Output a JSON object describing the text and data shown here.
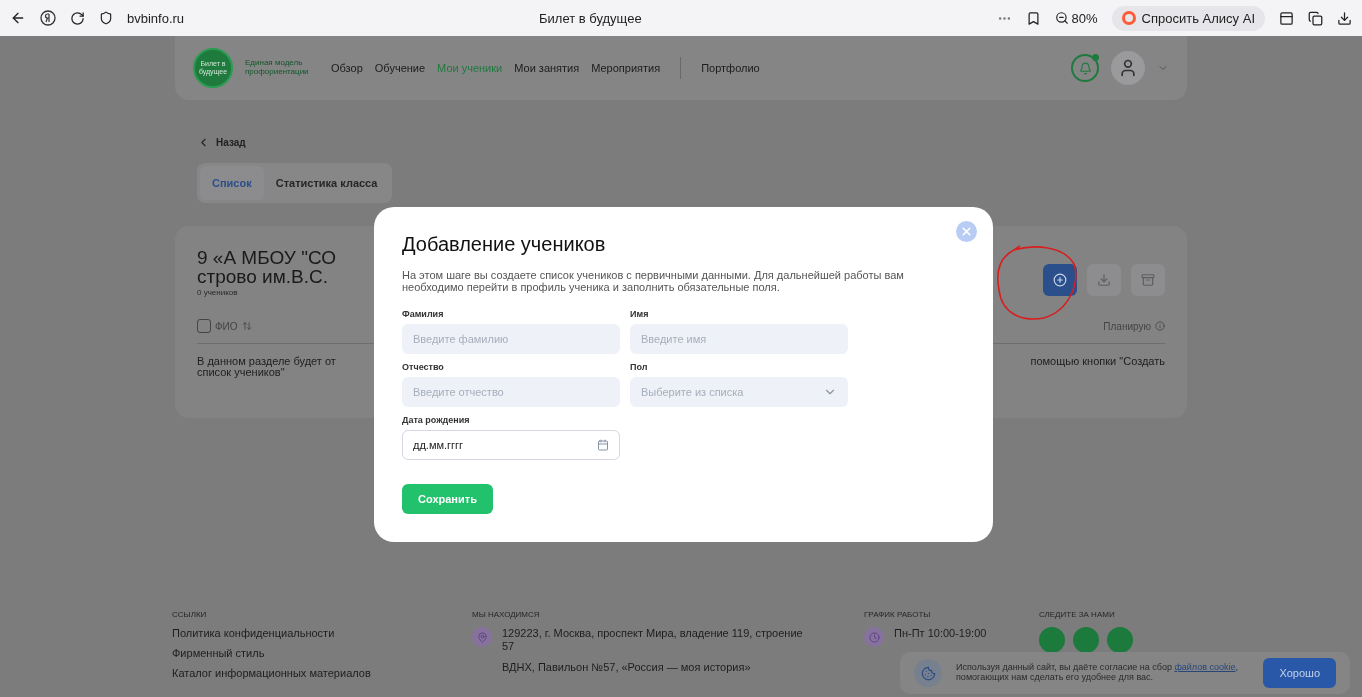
{
  "browser": {
    "url": "bvbinfo.ru",
    "title": "Билет в будущее",
    "zoom": "80%",
    "assistant": "Спросить Алису AI"
  },
  "header": {
    "logo_badge": "Билет в будущее",
    "logo_caption": "Единая модель профориентации",
    "nav": [
      {
        "label": "Обзор",
        "selected": false
      },
      {
        "label": "Обучение",
        "selected": false
      },
      {
        "label": "Мои ученики",
        "selected": true
      },
      {
        "label": "Мои занятия",
        "selected": false
      },
      {
        "label": "Мероприятия",
        "selected": false
      }
    ],
    "extra_link": "Портфолио",
    "has_notification": true
  },
  "back": "Назад",
  "tabs": [
    {
      "label": "Список",
      "selected": true
    },
    {
      "label": "Статистика класса",
      "selected": false
    }
  ],
  "class_card": {
    "title_lines": [
      "9 «А МБОУ \"СО",
      "строво им.В.С."
    ],
    "count": "0 учеников",
    "select_all_checked": false,
    "columns": [
      "ФИО",
      "Планирую"
    ],
    "empty_text_start": "В данном разделе будет от",
    "empty_text_start_2": "список учеников\"",
    "empty_text_end": "помощью кнопки \"Создать"
  },
  "modal": {
    "title": "Добавление учеников",
    "description": "На этом шаге вы создаете список учеников с первичными данными. Для дальнейшей работы вам необходимо перейти в профиль ученика и заполнить обязательные поля.",
    "fields": [
      {
        "kind": "text",
        "label": "Фамилия",
        "placeholder": "Введите фамилию"
      },
      {
        "kind": "text",
        "label": "Имя",
        "placeholder": "Введите имя"
      },
      {
        "kind": "text",
        "label": "Отчество",
        "placeholder": "Введите отчество"
      },
      {
        "kind": "select",
        "label": "Пол",
        "placeholder": "Выберите из списка"
      },
      {
        "kind": "date",
        "label": "Дата рождения",
        "value": "дд.мм.гггг"
      }
    ],
    "save": "Сохранить"
  },
  "footer": {
    "links_heading": "ССЫЛКИ",
    "links": [
      "Политика конфиденциальности",
      "Фирменный стиль",
      "Каталог информационных материалов"
    ],
    "location_heading": "МЫ НАХОДИМСЯ",
    "address": "129223, г. Москва, проспект Мира, владение 119, строение 57",
    "venue": "ВДНХ, Павильон №57, «Россия — моя история»",
    "schedule_heading": "ГРАФИК РАБОТЫ",
    "schedule": "Пн-Пт 10:00-19:00",
    "social_heading": "СЛЕДИТЕ ЗА НАМИ"
  },
  "cookie": {
    "text_before": "Используя данный сайт, вы даёте согласие на сбор ",
    "link": "файлов cookie",
    "text_after": ", помогающих нам сделать его удобнее для вас.",
    "button": "Хорошо"
  }
}
